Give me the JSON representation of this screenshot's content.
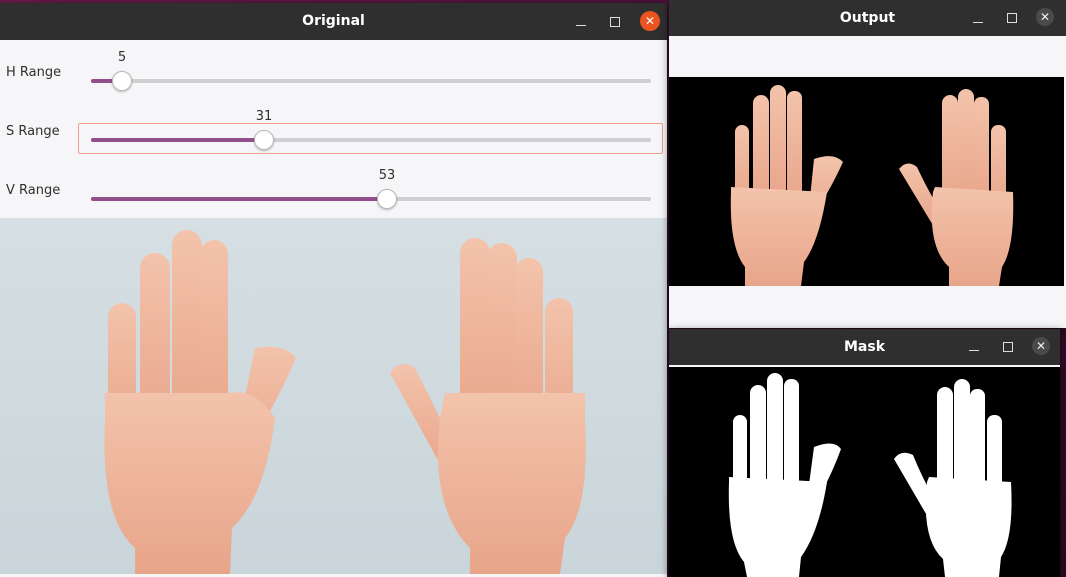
{
  "windows": {
    "original": {
      "title": "Original",
      "sliders": [
        {
          "label": "H Range",
          "value": "5",
          "fraction": 0.054
        },
        {
          "label": "S Range",
          "value": "31",
          "fraction": 0.309
        },
        {
          "label": "V Range",
          "value": "53",
          "fraction": 0.53
        }
      ]
    },
    "output": {
      "title": "Output"
    },
    "mask": {
      "title": "Mask"
    }
  },
  "colors": {
    "accent_fill": "#924d8b",
    "close_active": "#e95420",
    "titlebar": "#2f2f30",
    "skin": "#f0b49a"
  },
  "icons": {
    "minimize": "minimize-icon",
    "maximize": "maximize-icon",
    "close": "close-icon"
  }
}
